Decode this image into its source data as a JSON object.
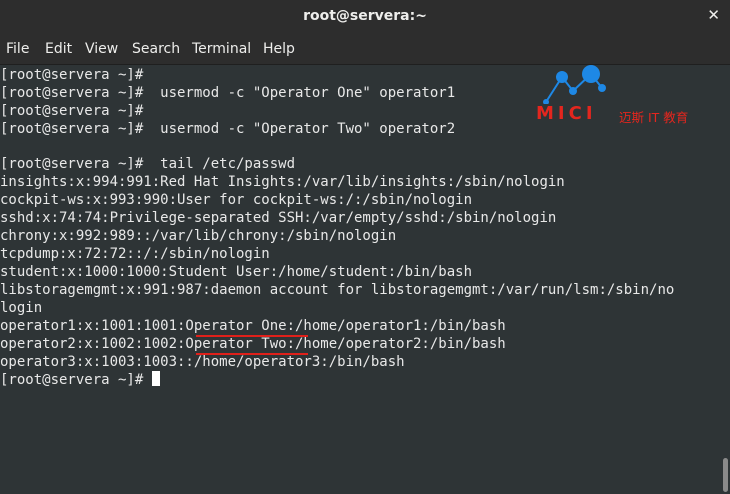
{
  "window": {
    "title": "root@servera:~",
    "close_label": "✕"
  },
  "menu": [
    "File",
    "Edit",
    "View",
    "Search",
    "Terminal",
    "Help"
  ],
  "terminal": {
    "lines": [
      "[root@servera ~]#",
      "[root@servera ~]#  usermod -c \"Operator One\" operator1",
      "[root@servera ~]#",
      "[root@servera ~]#  usermod -c \"Operator Two\" operator2",
      "[root@servera ~]#  tail /etc/passwd",
      "insights:x:994:991:Red Hat Insights:/var/lib/insights:/sbin/nologin",
      "cockpit-ws:x:993:990:User for cockpit-ws:/:/sbin/nologin",
      "sshd:x:74:74:Privilege-separated SSH:/var/empty/sshd:/sbin/nologin",
      "chrony:x:992:989::/var/lib/chrony:/sbin/nologin",
      "tcpdump:x:72:72::/:/sbin/nologin",
      "student:x:1000:1000:Student User:/home/student:/bin/bash",
      "libstoragemgmt:x:991:987:daemon account for libstoragemgmt:/var/run/lsm:/sbin/no",
      "login",
      "operator1:x:1001:1001:Operator One:/home/operator1:/bin/bash",
      "operator2:x:1002:1002:Operator Two:/home/operator2:/bin/bash",
      "operator3:x:1003:1003::/home/operator3:/bin/bash"
    ],
    "prompt": "[root@servera ~]# "
  },
  "logo": {
    "brand": "MICI",
    "sub": "迈斯 IT 教育"
  },
  "colors": {
    "background": "#2e3436",
    "text": "#e8e8e8",
    "titlebar": "#2d2d2d",
    "underline": "#e0201a",
    "logo": "#e3261e"
  }
}
